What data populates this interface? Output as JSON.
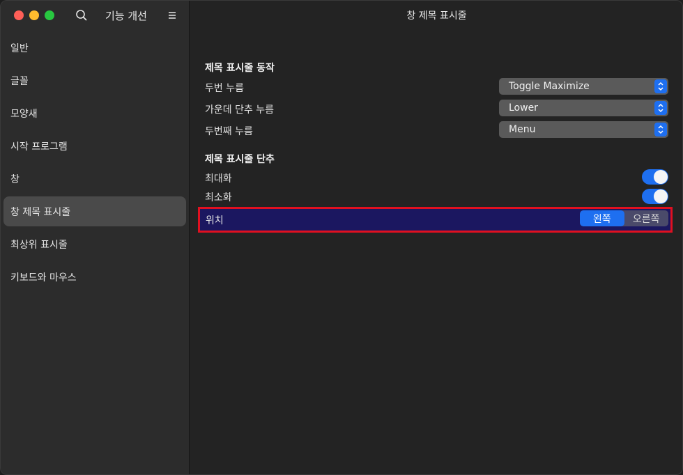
{
  "app": {
    "title": "기능 개선"
  },
  "sidebar": {
    "items": [
      {
        "label": "일반",
        "active": false
      },
      {
        "label": "글꼴",
        "active": false
      },
      {
        "label": "모양새",
        "active": false
      },
      {
        "label": "시작 프로그램",
        "active": false
      },
      {
        "label": "창",
        "active": false
      },
      {
        "label": "창 제목 표시줄",
        "active": true
      },
      {
        "label": "최상위 표시줄",
        "active": false
      },
      {
        "label": "키보드와 마우스",
        "active": false
      }
    ]
  },
  "main": {
    "title": "창 제목 표시줄",
    "actions_section": {
      "header": "제목 표시줄 동작",
      "rows": [
        {
          "label": "두번 누름",
          "value": "Toggle Maximize"
        },
        {
          "label": "가운데 단추 누름",
          "value": "Lower"
        },
        {
          "label": "두번째 누름",
          "value": "Menu"
        }
      ]
    },
    "buttons_section": {
      "header": "제목 표시줄 단추",
      "maximize": {
        "label": "최대화",
        "on": true
      },
      "minimize": {
        "label": "최소화",
        "on": true
      },
      "placement": {
        "label": "위치",
        "options": [
          "왼쪽",
          "오른쪽"
        ],
        "selected": "왼쪽"
      }
    }
  },
  "colors": {
    "accent": "#1e6ff0",
    "highlight_border": "#e01020",
    "highlight_fill": "#1b1760"
  }
}
